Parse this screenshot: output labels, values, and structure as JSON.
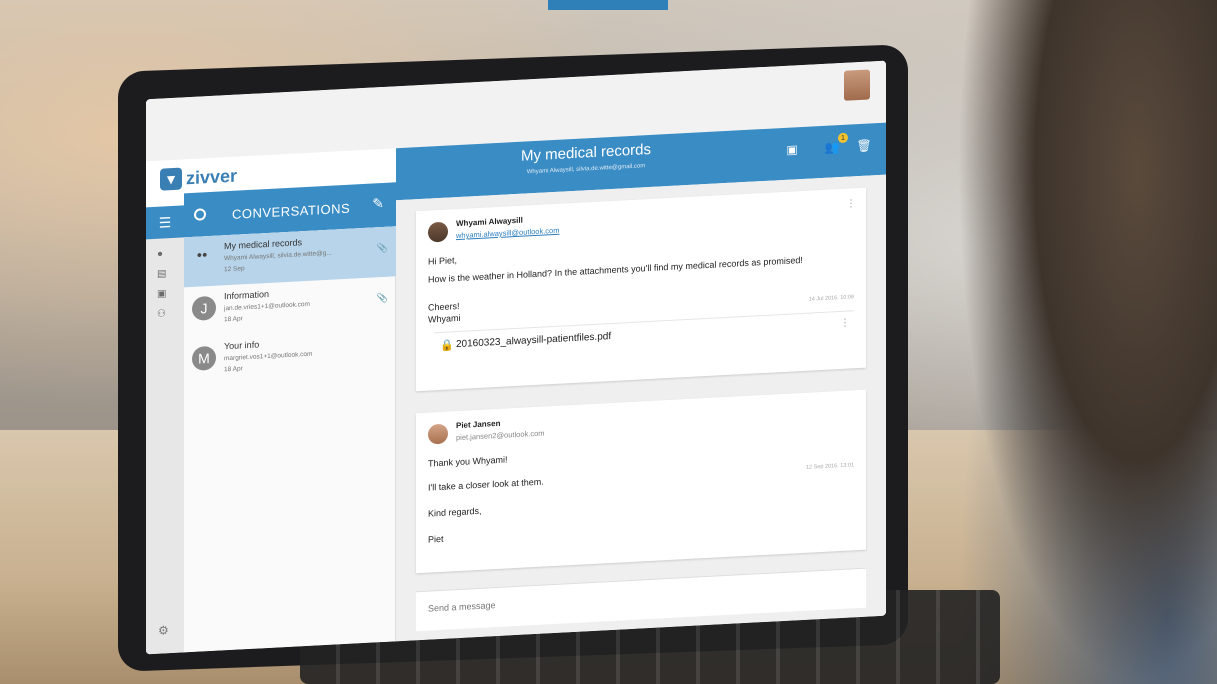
{
  "app": {
    "logo_text": "zivver",
    "conversations_title": "CONVERSATIONS"
  },
  "header": {
    "title": "My medical records",
    "subtitle": "Whyami Alwaysill, silvia.de.witte@gmail.com",
    "badge_count": "1"
  },
  "conversations": [
    {
      "name": "My medical records",
      "email": "Whyami Alwaysill, silvia.de.witte@g...",
      "date": "12 Sep",
      "active": true
    },
    {
      "name": "Information",
      "email": "jan.de.vries1+1@outlook.com",
      "date": "18 Apr",
      "initial": "J"
    },
    {
      "name": "Your info",
      "email": "margriet.vos1+1@outlook.com",
      "date": "18 Apr",
      "initial": "M"
    }
  ],
  "messages": [
    {
      "from": "Whyami Alwaysill",
      "email": "whyami.alwaysill@outlook.com",
      "lines": [
        "Hi Piet,",
        "How is the weather in Holland? In the attachments you'll find my medical records as promised!",
        "Cheers!",
        "Whyami"
      ],
      "time": "14 Jul 2016, 10:09",
      "attachment": "20160323_alwaysill-patientfiles.pdf"
    },
    {
      "from": "Piet Jansen",
      "email": "piet.jansen2@outlook.com",
      "lines": [
        "Thank you Whyami!",
        "I'll take a closer look at them.",
        "Kind regards,",
        "Piet"
      ],
      "time": "12 Sep 2016, 13:01"
    }
  ],
  "composer": {
    "placeholder": "Send a message"
  },
  "icons": {
    "menu": "menu-icon",
    "compose": "pencil-icon",
    "attachment": "paperclip-icon",
    "lock": "lock-icon",
    "settings": "gear-icon"
  },
  "colors": {
    "primary": "#3a8cc4",
    "active_item": "#b7d4ea"
  }
}
